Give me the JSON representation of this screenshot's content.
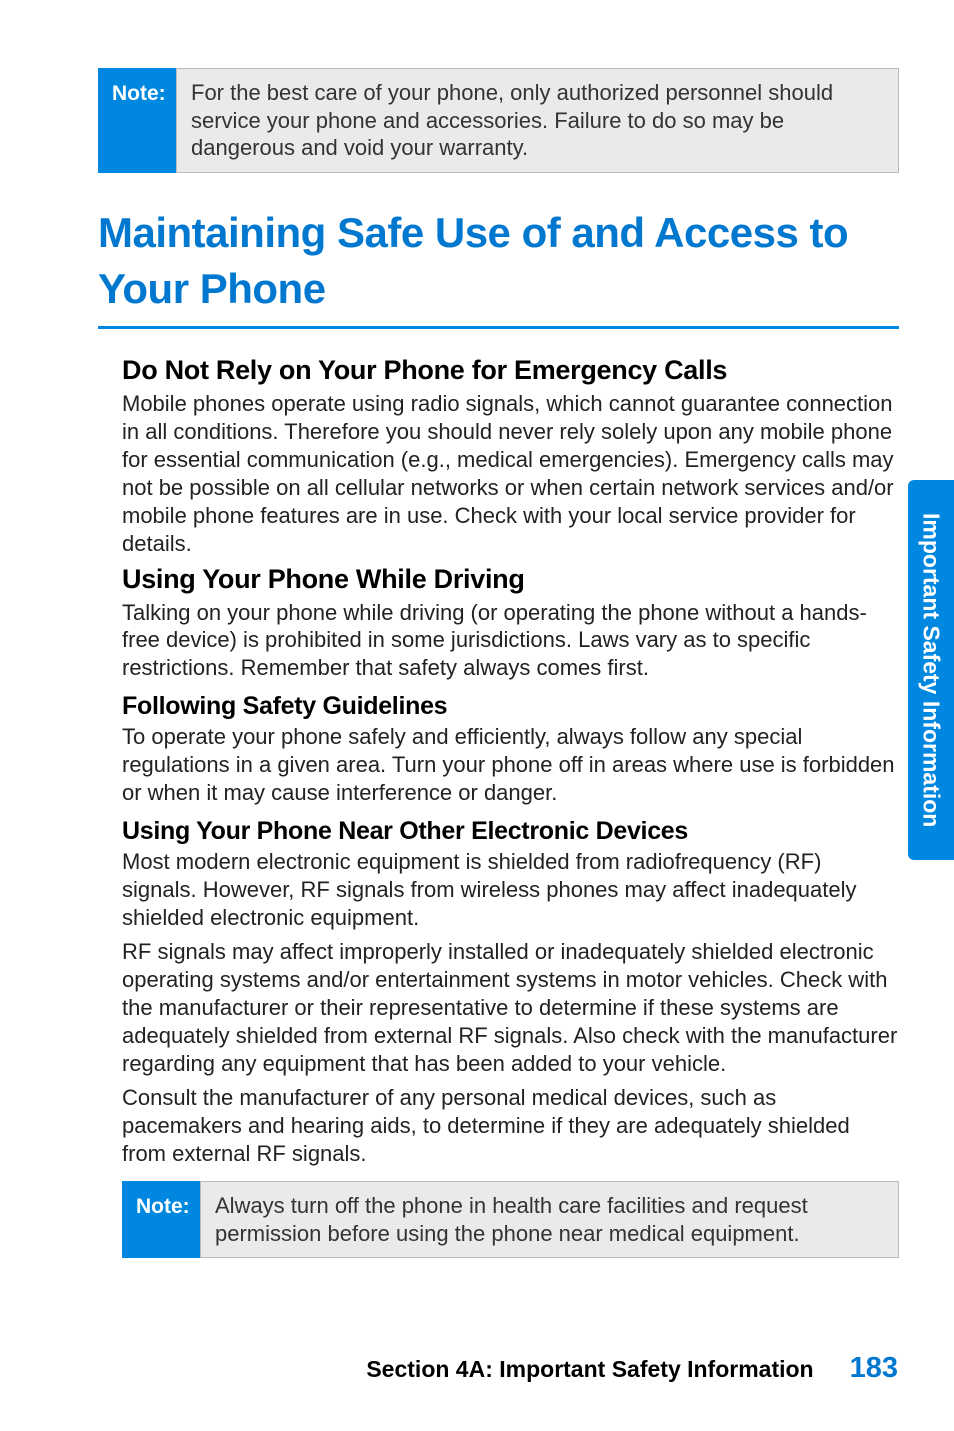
{
  "note1": {
    "label": "Note:",
    "text": "For the best care of your phone, only authorized personnel should service your phone and accessories. Failure to do so may be dangerous and void your warranty."
  },
  "title": "Maintaining Safe Use of and Access to Your Phone",
  "sections": {
    "emergency": {
      "heading": "Do Not Rely on Your Phone for Emergency Calls",
      "body": "Mobile phones operate using radio signals, which cannot guarantee connection in all conditions. Therefore you should never rely solely upon any mobile phone for essential communication (e.g., medical emergencies). Emergency calls may not be possible on all cellular networks or when certain network services and/or mobile phone features are in use. Check with your local service provider for details."
    },
    "driving": {
      "heading": "Using Your Phone While Driving",
      "body": "Talking on your phone while driving (or operating the phone without a hands-free device) is prohibited in some jurisdictions. Laws vary as to specific restrictions. Remember that safety always comes first."
    },
    "guidelines": {
      "heading": "Following Safety Guidelines",
      "body": "To operate your phone safely and efficiently, always follow any special regulations in a given area. Turn your phone off in areas where use is forbidden or when it may cause interference or danger."
    },
    "electronics": {
      "heading": "Using Your Phone Near Other Electronic Devices",
      "p1": "Most modern electronic equipment is shielded from radiofrequency (RF) signals. However, RF signals from wireless phones may affect inadequately shielded electronic equipment.",
      "p2": "RF signals may affect improperly installed or inadequately shielded electronic operating systems and/or entertainment systems in motor vehicles. Check with the manufacturer or their representative to determine if these systems are adequately shielded from external RF signals. Also check with the manufacturer regarding any equipment that has been added to your vehicle.",
      "p3": "Consult the manufacturer of any personal medical devices, such as pacemakers and hearing aids, to determine if they are adequately shielded from external RF signals."
    }
  },
  "note2": {
    "label": "Note:",
    "text": "Always turn off the phone in health care facilities and request permission before using the phone near medical equipment."
  },
  "sideTab": "Important Safety Information",
  "footer": {
    "section": "Section 4A: Important Safety Information",
    "page": "183"
  }
}
